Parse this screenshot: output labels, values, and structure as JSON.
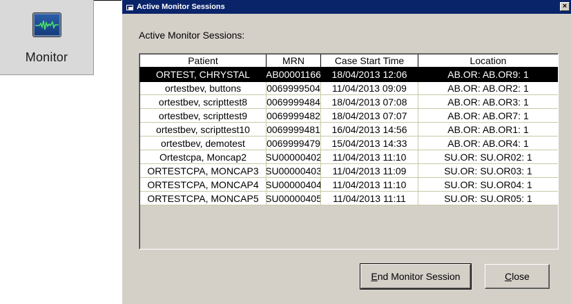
{
  "launcher": {
    "label": "Monitor",
    "icon": "waveform-monitor-icon"
  },
  "dialog": {
    "title": "Active Monitor Sessions",
    "close_glyph": "×",
    "section_label": "Active Monitor Sessions:",
    "columns": [
      "Patient",
      "MRN",
      "Case Start Time",
      "Location"
    ],
    "rows": [
      {
        "patient": "ORTEST, CHRYSTAL",
        "mrn": "AB00001166",
        "start": "18/04/2013 12:06",
        "location": "AB.OR: AB.OR9: 1",
        "selected": true
      },
      {
        "patient": "ortestbev, buttons",
        "mrn": "0069999504",
        "start": "11/04/2013 09:09",
        "location": "AB.OR: AB.OR2: 1"
      },
      {
        "patient": "ortestbev, scripttest8",
        "mrn": "0069999484",
        "start": "18/04/2013 07:08",
        "location": "AB.OR: AB.OR3: 1"
      },
      {
        "patient": "ortestbev, scripttest9",
        "mrn": "0069999482",
        "start": "18/04/2013 07:07",
        "location": "AB.OR: AB.OR7: 1"
      },
      {
        "patient": "ortestbev, scripttest10",
        "mrn": "0069999481",
        "start": "16/04/2013 14:56",
        "location": "AB.OR: AB.OR1: 1"
      },
      {
        "patient": "ortestbev, demotest",
        "mrn": "0069999479",
        "start": "15/04/2013 14:33",
        "location": "AB.OR: AB.OR4: 1"
      },
      {
        "patient": "Ortestcpa, Moncap2",
        "mrn": "SU00000402",
        "start": "11/04/2013 11:10",
        "location": "SU.OR: SU.OR02: 1"
      },
      {
        "patient": "ORTESTCPA, MONCAP3",
        "mrn": "SU00000403",
        "start": "11/04/2013 11:09",
        "location": "SU.OR: SU.OR03: 1"
      },
      {
        "patient": "ORTESTCPA, MONCAP4",
        "mrn": "SU00000404",
        "start": "11/04/2013 11:10",
        "location": "SU.OR: SU.OR04: 1"
      },
      {
        "patient": "ORTESTCPA, MONCAP5",
        "mrn": "SU00000405",
        "start": "11/04/2013 11:11",
        "location": "SU.OR: SU.OR05: 1"
      }
    ],
    "buttons": {
      "end_mnemonic": "E",
      "end_rest": "nd Monitor Session",
      "close_mnemonic": "C",
      "close_rest": "lose"
    }
  },
  "colors": {
    "titlebar": "#0a246a",
    "dialog_face": "#d4d0c8",
    "selected_row": "#000000"
  }
}
